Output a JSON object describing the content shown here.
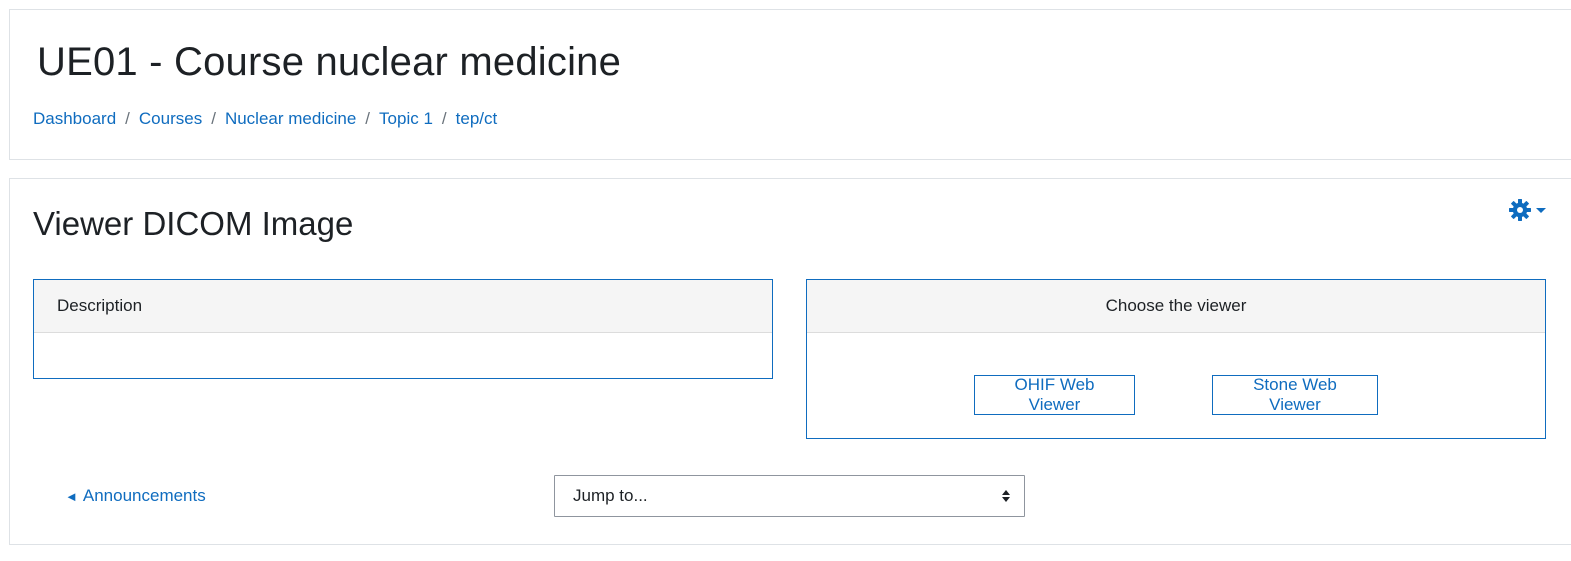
{
  "header": {
    "title": "UE01 - Course nuclear medicine",
    "breadcrumb": [
      {
        "label": "Dashboard"
      },
      {
        "label": "Courses"
      },
      {
        "label": "Nuclear medicine"
      },
      {
        "label": "Topic 1"
      },
      {
        "label": "tep/ct"
      }
    ],
    "separator": "/"
  },
  "main": {
    "title": "Viewer DICOM Image",
    "settings_icon": "gear-icon",
    "description_panel": {
      "heading": "Description",
      "body": ""
    },
    "viewer_panel": {
      "heading": "Choose the viewer",
      "buttons": [
        {
          "label": "OHIF Web Viewer"
        },
        {
          "label": "Stone Web Viewer"
        }
      ]
    }
  },
  "footer_nav": {
    "prev_arrow": "◄",
    "prev_label": "Announcements",
    "jump_placeholder": "Jump to..."
  },
  "colors": {
    "link": "#0f6cbf",
    "text": "#1d2125",
    "panel_header_bg": "#f5f5f5"
  }
}
